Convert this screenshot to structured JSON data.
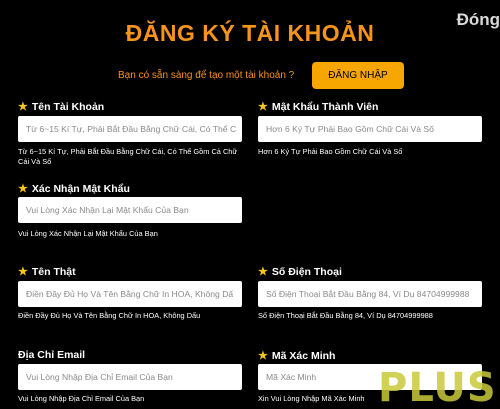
{
  "page": {
    "title": "ĐĂNG KÝ TÀI KHOẢN",
    "close_label": "Đóng"
  },
  "login": {
    "prompt": "Bạn có sẵn sàng để tạo một tài khoản ?",
    "button_label": "ĐĂNG NHẬP"
  },
  "fields": {
    "username": {
      "label": "Tên Tài Khoản",
      "placeholder": "Từ 6~15 Kí Tự, Phải Bắt Đầu Bằng Chữ Cái, Có Thể C",
      "hint": "Từ 6~15 Kí Tự, Phải Bắt Đầu Bằng Chữ Cái, Có Thể Gồm Cả Chữ Cái Và Số"
    },
    "password": {
      "label": "Mật Khẩu Thành Viên",
      "placeholder": "Hơn 6 Ký Tự Phải Bao Gồm Chữ Cái Và Số",
      "hint": "Hơn 6 Ký Tự Phải Bao Gồm Chữ Cái Và Số"
    },
    "confirm_password": {
      "label": "Xác Nhận Mật Khẩu",
      "placeholder": "Vui Lòng Xác Nhận Lại Mật Khẩu Của Bạn",
      "hint": "Vui Lòng Xác Nhận Lại Mật Khẩu Của Bạn"
    },
    "real_name": {
      "label": "Tên Thật",
      "placeholder": "Điền Đầy Đủ Họ Và Tên Bằng Chữ In HOA, Không Dấ",
      "hint": "Điền Đầy Đủ Họ Và Tên Bằng Chữ In HOA, Không Dấu"
    },
    "phone": {
      "label": "Số Điện Thoại",
      "placeholder": "Số Điện Thoại Bắt Đầu Bằng 84, Ví Dụ 84704999988",
      "hint": "Số Điện Thoại Bắt Đầu Bằng 84, Ví Dụ 84704999988"
    },
    "email": {
      "label": "Địa Chỉ Email",
      "placeholder": "Vui Lòng Nhập Địa Chỉ Email Của Bạn",
      "hint": "Vui Lòng Nhập Địa Chỉ Email Của Bạn"
    },
    "verify_code": {
      "label": "Mã Xác Minh",
      "placeholder": "Mã Xác Minh",
      "hint": "Xin Vui Lòng Nhập Mã Xác Minh"
    }
  },
  "watermark": "PLUS",
  "colors": {
    "accent": "#f7941d",
    "button": "#f7a600",
    "star": "#f5c518"
  }
}
